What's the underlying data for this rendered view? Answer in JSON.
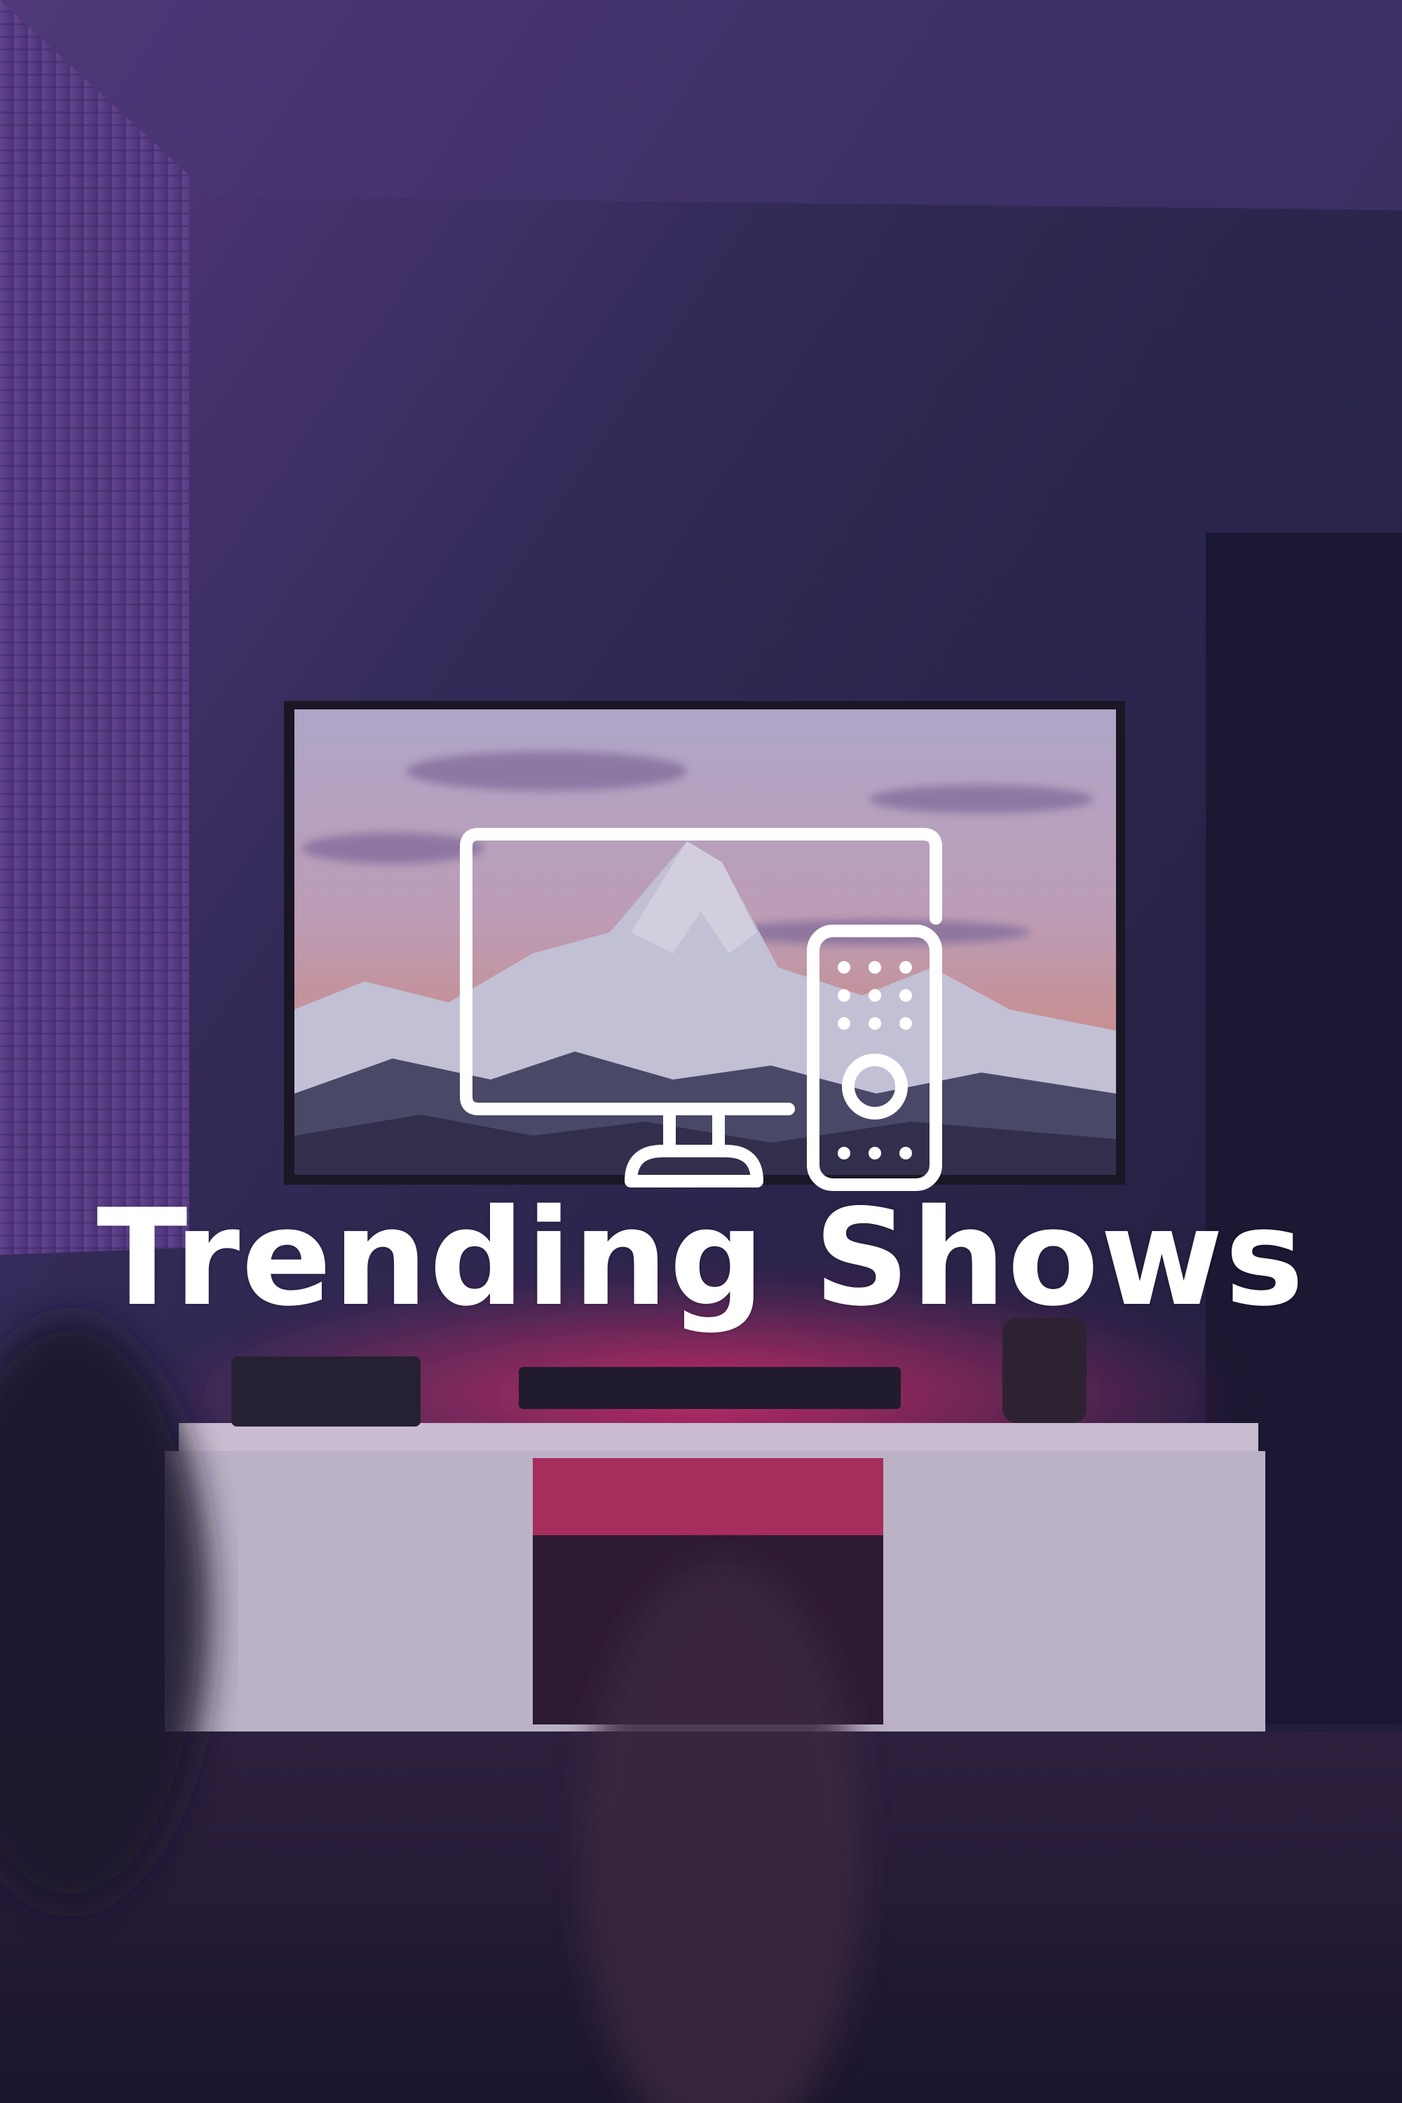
{
  "title": "Trending Shows",
  "icon": "tv-with-remote-icon",
  "colors": {
    "text": "#ffffff",
    "wall": "#2a2748",
    "accent_glow": "#ff2d6f",
    "sky": "#cfc3d8"
  }
}
